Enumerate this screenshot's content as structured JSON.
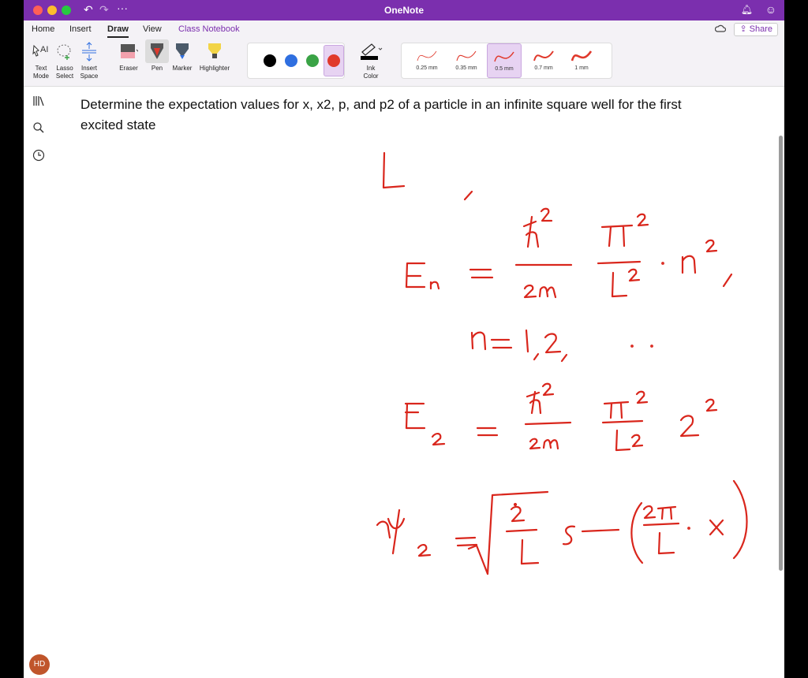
{
  "window": {
    "title": "OneNote"
  },
  "menu": {
    "home": "Home",
    "insert": "Insert",
    "draw": "Draw",
    "view": "View",
    "class_notebook": "Class Notebook",
    "share": "Share"
  },
  "ribbon": {
    "text_mode_1": "Text",
    "text_mode_2": "Mode",
    "lasso_1": "Lasso",
    "lasso_2": "Select",
    "insert_space_1": "Insert",
    "insert_space_2": "Space",
    "eraser": "Eraser",
    "pen": "Pen",
    "marker": "Marker",
    "highlighter": "Highlighter",
    "ink_color_1": "Ink",
    "ink_color_2": "Color",
    "pen_colors": [
      "#000000",
      "#2f6fe0",
      "#3aa346",
      "#e0392c"
    ],
    "pen_sizes": [
      "0.25 mm",
      "0.35 mm",
      "0.5 mm",
      "0.7 mm",
      "1 mm"
    ],
    "selected_size": "0.5 mm"
  },
  "sidebar": {
    "avatar_initials": "HD"
  },
  "note": {
    "question": "Determine the expectation values for x, x2, p, and p2 of a particle in an infinite square well for the first excited state"
  },
  "colors": {
    "accent": "#7b2fae",
    "ink": "#d9261c"
  }
}
